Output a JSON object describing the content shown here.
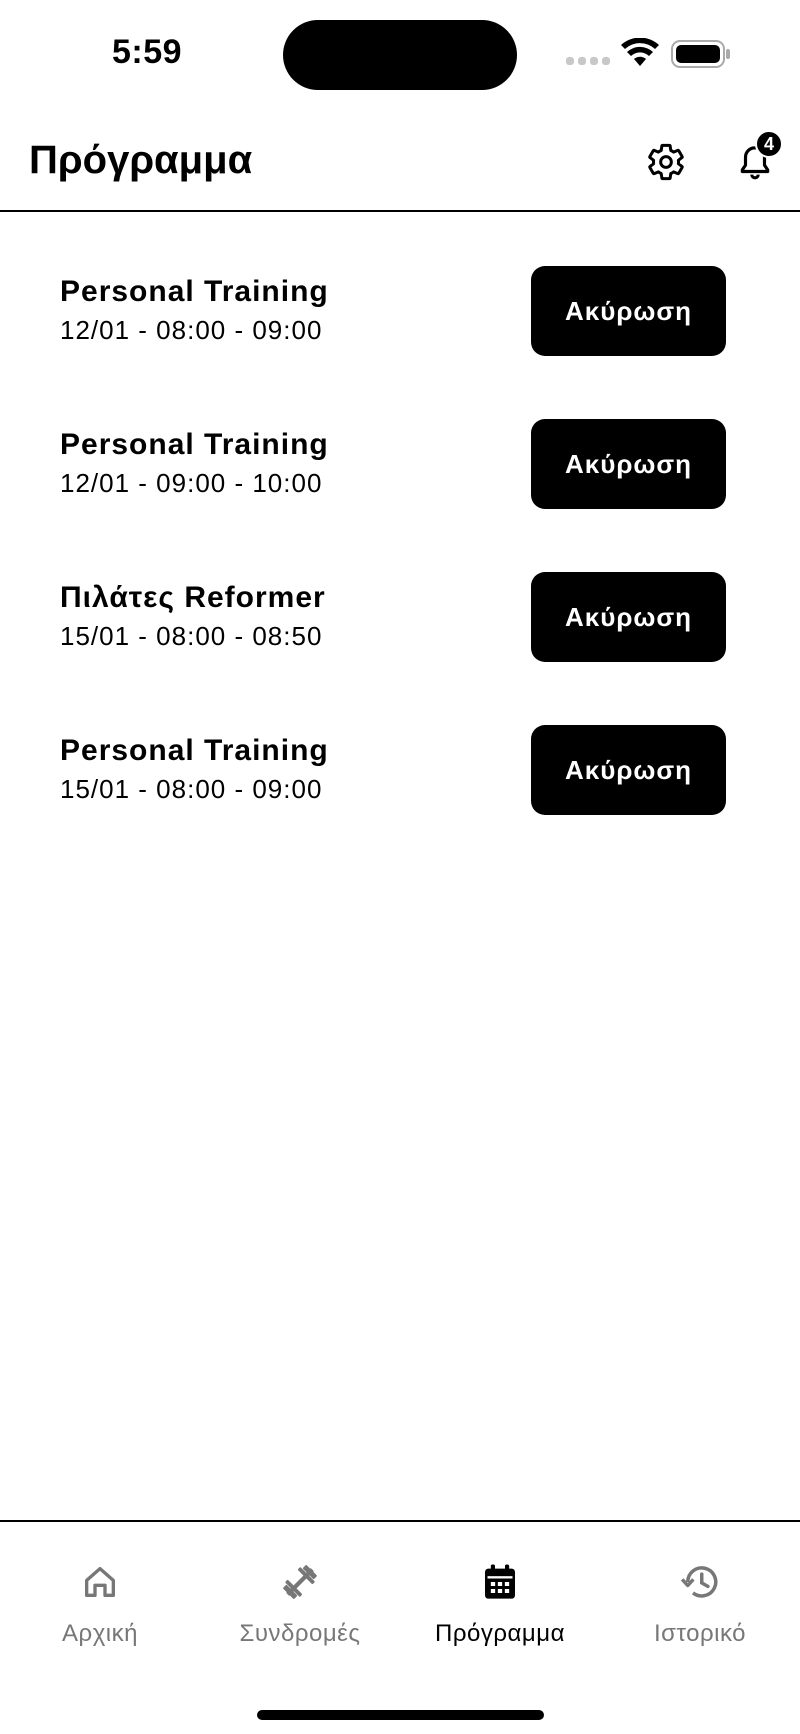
{
  "status_bar": {
    "time": "5:59"
  },
  "header": {
    "title": "Πρόγραμμα",
    "notification_count": "4"
  },
  "sessions": [
    {
      "name": "Personal Training",
      "time": "12/01 - 08:00 - 09:00",
      "action_label": "Ακύρωση"
    },
    {
      "name": "Personal Training",
      "time": "12/01 - 09:00 - 10:00",
      "action_label": "Ακύρωση"
    },
    {
      "name": "Πιλάτες Reformer",
      "time": "15/01 - 08:00 - 08:50",
      "action_label": "Ακύρωση"
    },
    {
      "name": "Personal Training",
      "time": "15/01 - 08:00 - 09:00",
      "action_label": "Ακύρωση"
    }
  ],
  "bottom_nav": {
    "items": [
      {
        "label": "Αρχική",
        "icon": "home-icon",
        "active": false
      },
      {
        "label": "Συνδρομές",
        "icon": "dumbbell-icon",
        "active": false
      },
      {
        "label": "Πρόγραμμα",
        "icon": "calendar-icon",
        "active": true
      },
      {
        "label": "Ιστορικό",
        "icon": "history-icon",
        "active": false
      }
    ]
  },
  "colors": {
    "primary": "#000000",
    "background": "#ffffff",
    "inactive_nav": "#777777"
  }
}
